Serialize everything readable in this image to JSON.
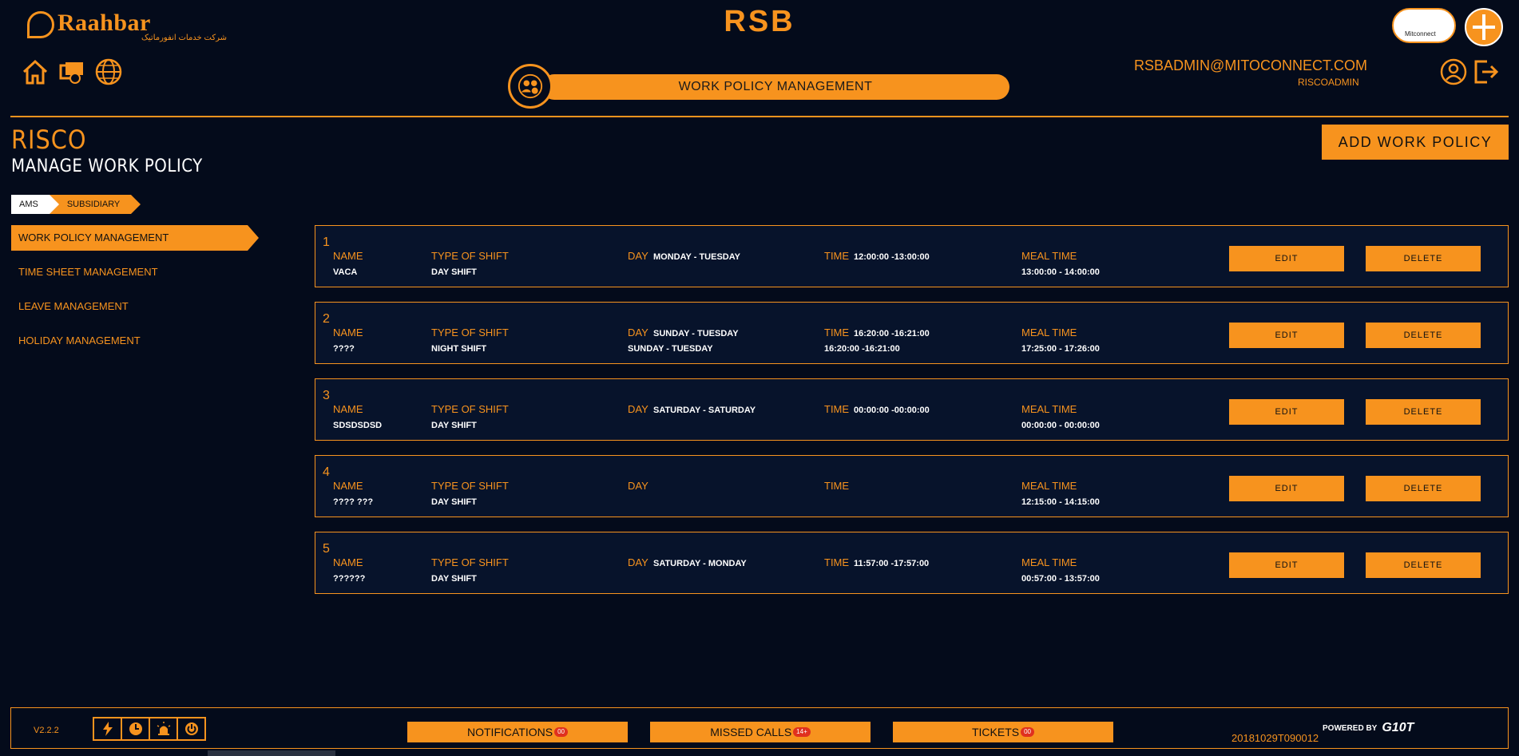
{
  "header": {
    "logo_text": "Raahbar",
    "logo_subtitle": "شرکت خدمات انفورماتیک",
    "app_title": "RSB",
    "cloud_logo_text": "Mitconnect",
    "page_banner": "WORK POLICY MANAGEMENT",
    "user_email": "RSBADMIN@MITOCONNECT.COM",
    "user_role": "RISCOADMIN",
    "icons": [
      "home-icon",
      "cards-icon",
      "language-icon",
      "user-icon",
      "logout-icon"
    ]
  },
  "title": {
    "company": "RISCO",
    "page": "MANAGE WORK POLICY",
    "add_button": "ADD WORK POLICY"
  },
  "breadcrumb": [
    "AMS",
    "SUBSIDIARY"
  ],
  "sidebar": {
    "items": [
      {
        "label": "WORK POLICY MANAGEMENT",
        "active": true
      },
      {
        "label": "TIME SHEET MANAGEMENT",
        "active": false
      },
      {
        "label": "LEAVE MANAGEMENT",
        "active": false
      },
      {
        "label": "HOLIDAY MANAGEMENT",
        "active": false
      }
    ]
  },
  "labels": {
    "name": "NAME",
    "type": "TYPE OF SHIFT",
    "day": "DAY",
    "time": "TIME",
    "meal": "MEAL TIME",
    "edit": "EDIT",
    "delete": "DELETE"
  },
  "policies": [
    {
      "num": "1",
      "name": "VACA",
      "type": "DAY SHIFT",
      "day": "MONDAY - TUESDAY",
      "day_below": "",
      "time": "12:00:00 -13:00:00",
      "time_below": "",
      "meal": "13:00:00 - 14:00:00"
    },
    {
      "num": "2",
      "name": "????",
      "type": "NIGHT SHIFT",
      "day": "SUNDAY - TUESDAY",
      "day_below": "SUNDAY - TUESDAY",
      "time": "16:20:00 -16:21:00",
      "time_below": "16:20:00 -16:21:00",
      "meal": "17:25:00 - 17:26:00"
    },
    {
      "num": "3",
      "name": "SDSDSDSD",
      "type": "DAY SHIFT",
      "day": "SATURDAY - SATURDAY",
      "day_below": "",
      "time": "00:00:00 -00:00:00",
      "time_below": "",
      "meal": "00:00:00 - 00:00:00"
    },
    {
      "num": "4",
      "name": "???? ???",
      "type": "DAY SHIFT",
      "day": "",
      "day_below": "",
      "time": "",
      "time_below": "",
      "meal": "12:15:00 - 14:15:00"
    },
    {
      "num": "5",
      "name": "??????",
      "type": "DAY SHIFT",
      "day": "SATURDAY - MONDAY",
      "day_below": "",
      "time": "11:57:00 -17:57:00",
      "time_below": "",
      "meal": "00:57:00 - 13:57:00"
    }
  ],
  "footer": {
    "version": "V2.2.2",
    "notifications": "NOTIFICATIONS",
    "notifications_badge": "00",
    "missed_calls": "MISSED CALLS",
    "missed_calls_badge": "14+",
    "tickets": "TICKETS",
    "tickets_badge": "00",
    "build": "20181029T090012",
    "powered_by": "POWERED BY",
    "powered_brand": "G10T",
    "icons": [
      "lightning-icon",
      "clock-icon",
      "alarm-icon",
      "power-icon"
    ]
  },
  "colors": {
    "background": "#040b1b",
    "accent": "#f7931e",
    "card_bg": "#07132b",
    "badge": "#e0301e"
  }
}
